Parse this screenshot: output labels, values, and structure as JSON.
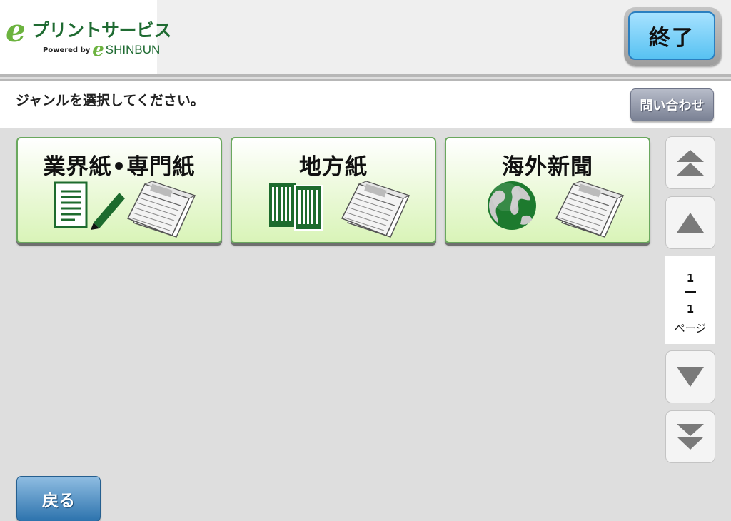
{
  "header": {
    "logo": {
      "brand_letter": "e",
      "brand_name": "プリントサービス",
      "powered_by": "Powered by",
      "sub_letter": "e",
      "sub_brand": "SHINBUN"
    },
    "end_button_label": "終了"
  },
  "instruction": {
    "text": "ジャンルを選択してください。",
    "contact_button_label": "問い合わせ"
  },
  "genres": [
    {
      "label": "業界紙•専門紙",
      "icon": "document-pen-newspaper-icon"
    },
    {
      "label": "地方紙",
      "icon": "local-newspapers-icon"
    },
    {
      "label": "海外新聞",
      "icon": "globe-newspaper-icon"
    }
  ],
  "pagination": {
    "current": "1",
    "total": "1",
    "suffix": "ページ",
    "buttons": [
      "first-page-icon",
      "previous-page-icon",
      "next-page-icon",
      "last-page-icon"
    ]
  },
  "footer": {
    "back_button_label": "戻る"
  },
  "colors": {
    "brand_green": "#1f6b32",
    "brand_light_green": "#6cb33f",
    "end_button_blue": "#58c2f2",
    "back_button_blue": "#2d73ad",
    "contact_button_gray": "#7a8194"
  }
}
